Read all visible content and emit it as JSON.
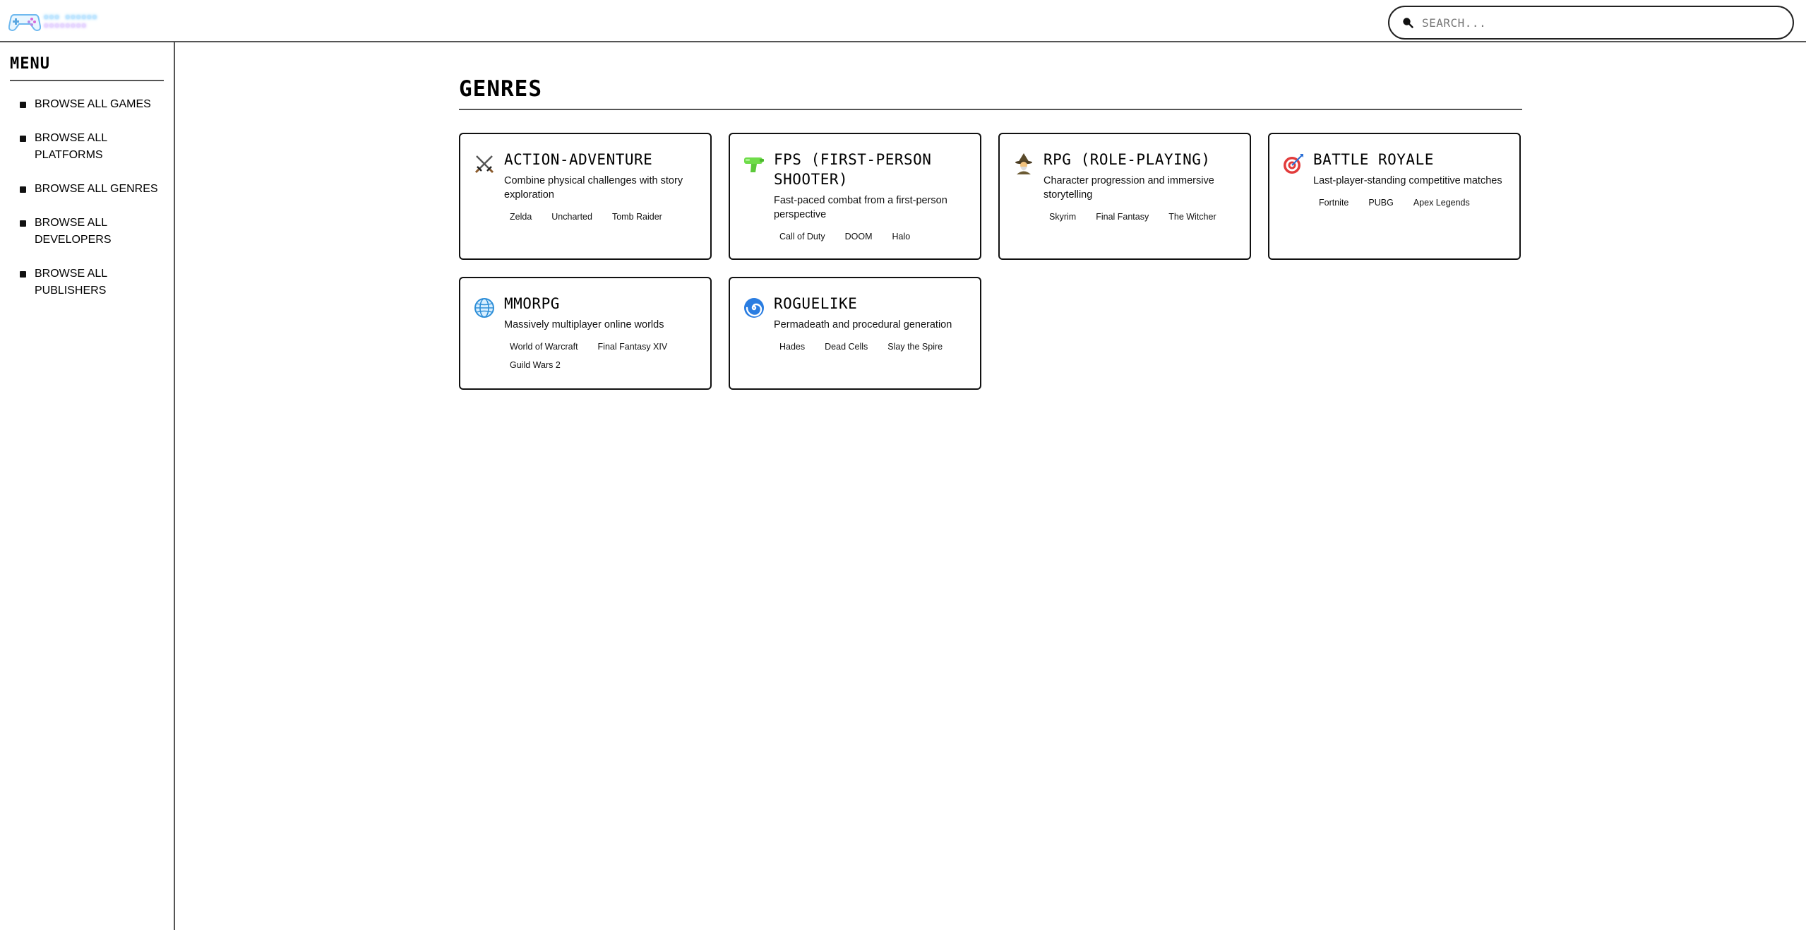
{
  "search": {
    "placeholder": "SEARCH..."
  },
  "sidebar": {
    "title": "MENU",
    "items": [
      {
        "label": "BROWSE ALL GAMES"
      },
      {
        "label": "BROWSE ALL PLATFORMS"
      },
      {
        "label": "BROWSE ALL GENRES"
      },
      {
        "label": "BROWSE ALL DEVELOPERS"
      },
      {
        "label": "BROWSE ALL PUBLISHERS"
      }
    ]
  },
  "main": {
    "title": "GENRES",
    "genres": [
      {
        "icon": "crossed-swords-icon",
        "title": "ACTION-ADVENTURE",
        "description": "Combine physical challenges with story exploration",
        "tags": [
          "Zelda",
          "Uncharted",
          "Tomb Raider"
        ]
      },
      {
        "icon": "water-pistol-icon",
        "title": "FPS (FIRST-PERSON SHOOTER)",
        "description": "Fast-paced combat from a first-person perspective",
        "tags": [
          "Call of Duty",
          "DOOM",
          "Halo"
        ]
      },
      {
        "icon": "mage-icon",
        "title": "RPG (ROLE-PLAYING)",
        "description": "Character progression and immersive storytelling",
        "tags": [
          "Skyrim",
          "Final Fantasy",
          "The Witcher"
        ]
      },
      {
        "icon": "target-icon",
        "title": "BATTLE ROYALE",
        "description": "Last-player-standing competitive matches",
        "tags": [
          "Fortnite",
          "PUBG",
          "Apex Legends"
        ]
      },
      {
        "icon": "globe-icon",
        "title": "MMORPG",
        "description": "Massively multiplayer online worlds",
        "tags": [
          "World of Warcraft",
          "Final Fantasy XIV",
          "Guild Wars 2"
        ]
      },
      {
        "icon": "cyclone-icon",
        "title": "ROGUELIKE",
        "description": "Permadeath and procedural generation",
        "tags": [
          "Hades",
          "Dead Cells",
          "Slay the Spire"
        ]
      }
    ]
  }
}
